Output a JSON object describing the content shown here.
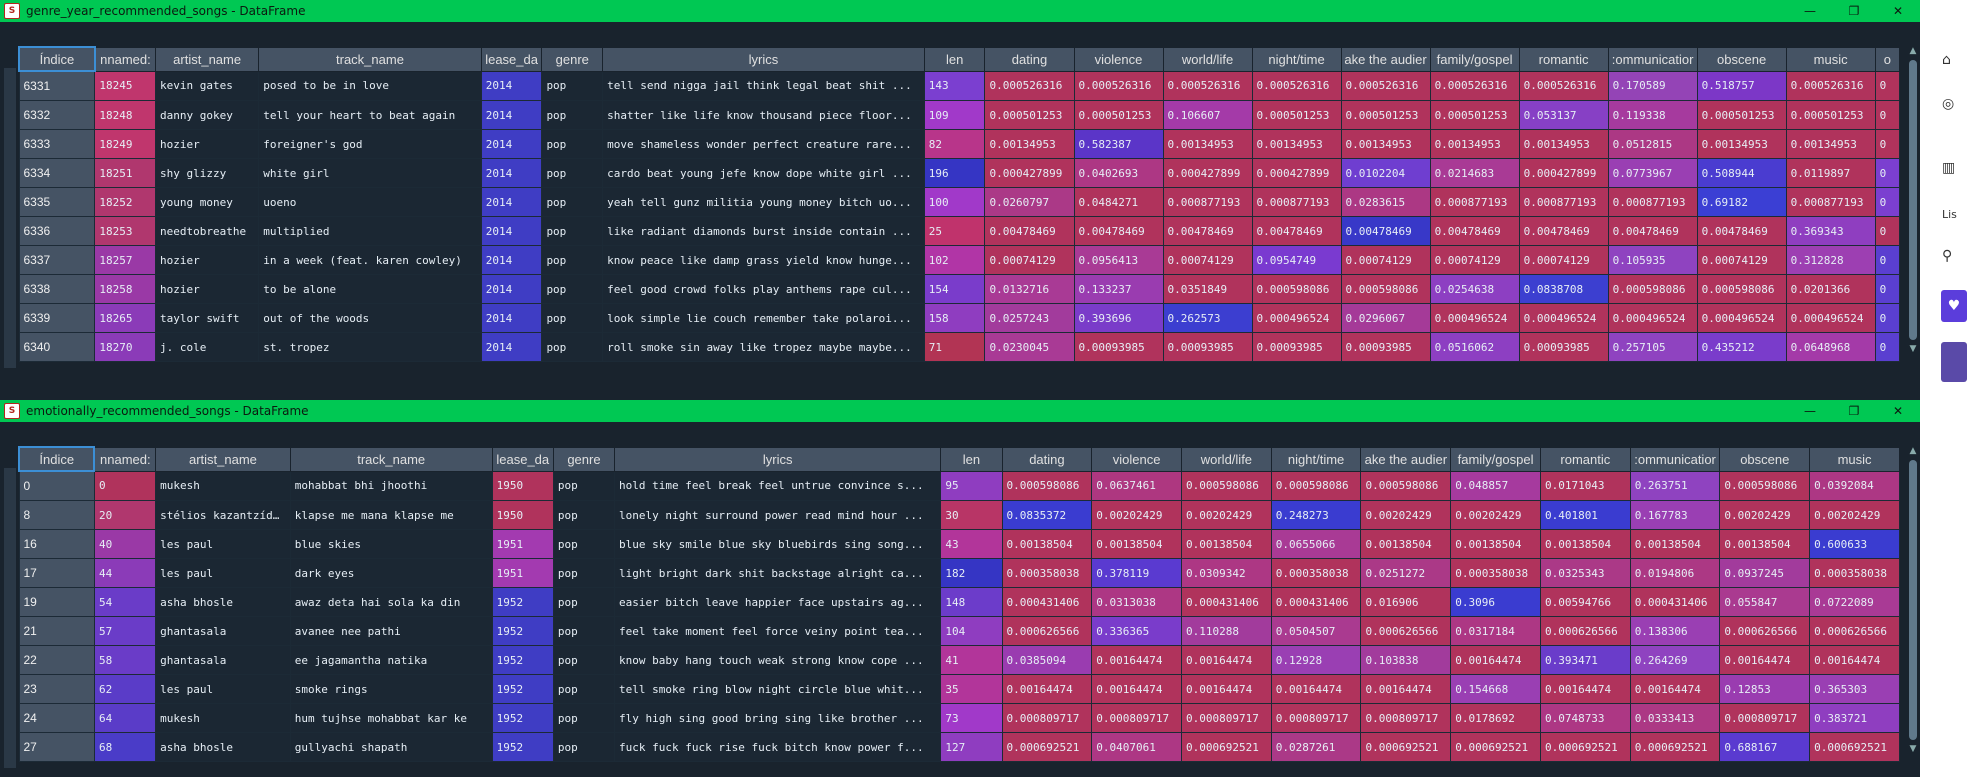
{
  "windows": [
    {
      "title": "genre_year_recommended_songs - DataFrame",
      "app_icon": "spyder-icon",
      "columns": [
        "Índice",
        "nnamed:",
        "artist_name",
        "track_name",
        "lease_da",
        "genre",
        "lyrics",
        "len",
        "dating",
        "violence",
        "world/life",
        "night/time",
        "ake the audier",
        "family/gospel",
        "romantic",
        ":ommunicatior",
        "obscene",
        "music",
        "o"
      ],
      "rows": [
        [
          "6331",
          "18245",
          "kevin gates",
          "posed to be in love",
          "2014",
          "pop",
          "tell send nigga jail think legal beat shit ...",
          "143",
          "0.000526316",
          "0.000526316",
          "0.000526316",
          "0.000526316",
          "0.000526316",
          "0.000526316",
          "0.000526316",
          "0.170589",
          "0.518757",
          "0.000526316",
          "0"
        ],
        [
          "6332",
          "18248",
          "danny gokey",
          "tell your heart to beat again",
          "2014",
          "pop",
          "shatter like life know thousand piece floor...",
          "109",
          "0.000501253",
          "0.000501253",
          "0.106607",
          "0.000501253",
          "0.000501253",
          "0.000501253",
          "0.053137",
          "0.119338",
          "0.000501253",
          "0.000501253",
          "0"
        ],
        [
          "6333",
          "18249",
          "hozier",
          "foreigner's god",
          "2014",
          "pop",
          "move shameless wonder perfect creature rare...",
          "82",
          "0.00134953",
          "0.582387",
          "0.00134953",
          "0.00134953",
          "0.00134953",
          "0.00134953",
          "0.00134953",
          "0.0512815",
          "0.00134953",
          "0.00134953",
          "0"
        ],
        [
          "6334",
          "18251",
          "shy glizzy",
          "white girl",
          "2014",
          "pop",
          "cardo beat young jefe know dope white girl ...",
          "196",
          "0.000427899",
          "0.0402693",
          "0.000427899",
          "0.000427899",
          "0.0102204",
          "0.0214683",
          "0.000427899",
          "0.0773967",
          "0.508944",
          "0.0119897",
          "0"
        ],
        [
          "6335",
          "18252",
          "young money",
          "uoeno",
          "2014",
          "pop",
          "yeah tell gunz militia young money bitch uo...",
          "100",
          "0.0260797",
          "0.0484271",
          "0.000877193",
          "0.000877193",
          "0.0283615",
          "0.000877193",
          "0.000877193",
          "0.000877193",
          "0.69182",
          "0.000877193",
          "0"
        ],
        [
          "6336",
          "18253",
          "needtobreathe",
          "multiplied",
          "2014",
          "pop",
          "like radiant diamonds burst inside contain ...",
          "25",
          "0.00478469",
          "0.00478469",
          "0.00478469",
          "0.00478469",
          "0.00478469",
          "0.00478469",
          "0.00478469",
          "0.00478469",
          "0.00478469",
          "0.369343",
          "0"
        ],
        [
          "6337",
          "18257",
          "hozier",
          "in a week (feat. karen cowley)",
          "2014",
          "pop",
          "know peace like damp grass yield know hunge...",
          "102",
          "0.00074129",
          "0.0956413",
          "0.00074129",
          "0.0954749",
          "0.00074129",
          "0.00074129",
          "0.00074129",
          "0.105935",
          "0.00074129",
          "0.312828",
          "0"
        ],
        [
          "6338",
          "18258",
          "hozier",
          "to be alone",
          "2014",
          "pop",
          "feel good crowd folks play anthems rape cul...",
          "154",
          "0.0132716",
          "0.133237",
          "0.0351849",
          "0.000598086",
          "0.000598086",
          "0.0254638",
          "0.0838708",
          "0.000598086",
          "0.000598086",
          "0.0201366",
          "0"
        ],
        [
          "6339",
          "18265",
          "taylor swift",
          "out of the woods",
          "2014",
          "pop",
          "look simple lie couch remember take polaroi...",
          "158",
          "0.0257243",
          "0.393696",
          "0.262573",
          "0.000496524",
          "0.0296067",
          "0.000496524",
          "0.000496524",
          "0.000496524",
          "0.000496524",
          "0.000496524",
          "0"
        ],
        [
          "6340",
          "18270",
          "j. cole",
          "st. tropez",
          "2014",
          "pop",
          "roll smoke sin away like tropez maybe maybe...",
          "71",
          "0.0230045",
          "0.00093985",
          "0.00093985",
          "0.00093985",
          "0.00093985",
          "0.0516062",
          "0.00093985",
          "0.257105",
          "0.435212",
          "0.0648968",
          "0"
        ]
      ],
      "cell_colors": [
        [
          "#455364",
          "#c0366d",
          "#1b2733",
          "#1b2733",
          "#3f3dc4",
          "#1b2733",
          "#1b2733",
          "#7b3fd0",
          "#b0335c",
          "#b0335c",
          "#b0335c",
          "#b0335c",
          "#b0335c",
          "#b0335c",
          "#b0335c",
          "#9444b6",
          "#7c37c7",
          "#b0335c",
          "#b0335c"
        ],
        [
          "#455364",
          "#c0366d",
          "#1b2733",
          "#1b2733",
          "#3f3dc4",
          "#1b2733",
          "#1b2733",
          "#a139c9",
          "#b0335c",
          "#b0335c",
          "#a43aa8",
          "#b0335c",
          "#b0335c",
          "#b0335c",
          "#8740c5",
          "#a63a9e",
          "#b0335c",
          "#b0335c",
          "#b0335c"
        ],
        [
          "#455364",
          "#c0366d",
          "#1b2733",
          "#1b2733",
          "#3f3dc4",
          "#1b2733",
          "#1b2733",
          "#b8358a",
          "#b0335c",
          "#5b35c8",
          "#b0335c",
          "#b0335c",
          "#b0335c",
          "#b0335c",
          "#b0335c",
          "#ac3884",
          "#b0335c",
          "#b0335c",
          "#b0335c"
        ],
        [
          "#455364",
          "#b0376e",
          "#1b2733",
          "#1b2733",
          "#3f3dc4",
          "#1b2733",
          "#1b2733",
          "#3535c4",
          "#b0335c",
          "#ad3784",
          "#b0335c",
          "#b0335c",
          "#6f3ed0",
          "#a93a95",
          "#b0335c",
          "#9a3fb3",
          "#4a3cd0",
          "#b0335c",
          "#7b3fd0"
        ],
        [
          "#455364",
          "#b0376e",
          "#1b2733",
          "#1b2733",
          "#3f3dc4",
          "#1b2733",
          "#1b2733",
          "#a139c9",
          "#ab3987",
          "#b0335c",
          "#b0335c",
          "#b0335c",
          "#ac3884",
          "#b0335c",
          "#b0335c",
          "#b0335c",
          "#3b3fd4",
          "#b0335c",
          "#7b3fd0"
        ],
        [
          "#455364",
          "#b0376e",
          "#1b2733",
          "#1b2733",
          "#3f3dc4",
          "#1b2733",
          "#1b2733",
          "#c0336c",
          "#b0335c",
          "#b0335c",
          "#b0335c",
          "#b0335c",
          "#3838c8",
          "#b0335c",
          "#b0335c",
          "#b0335c",
          "#b0335c",
          "#8f3ec0",
          "#b0335c"
        ],
        [
          "#455364",
          "#9a39a6",
          "#1b2733",
          "#1b2733",
          "#3f3dc4",
          "#1b2733",
          "#1b2733",
          "#b135a6",
          "#b0335c",
          "#a93a95",
          "#b0335c",
          "#7a3ad0",
          "#b0335c",
          "#b0335c",
          "#b0335c",
          "#8f43c0",
          "#b0335c",
          "#9d3fb2",
          "#5a3fd0"
        ],
        [
          "#455364",
          "#9a39a6",
          "#1b2733",
          "#1b2733",
          "#3f3dc4",
          "#1b2733",
          "#1b2733",
          "#7a3ccb",
          "#a93a95",
          "#9a3cb0",
          "#b0335c",
          "#b0335c",
          "#b0335c",
          "#8d3fc2",
          "#3c3fd0",
          "#b0335c",
          "#b0335c",
          "#b0335c",
          "#5a3fd0"
        ],
        [
          "#455364",
          "#8b3bb8",
          "#1b2733",
          "#1b2733",
          "#3f3dc4",
          "#1b2733",
          "#1b2733",
          "#8f3dc0",
          "#a23b9c",
          "#7a3cc9",
          "#3c3ed0",
          "#b0335c",
          "#a53a98",
          "#b0335c",
          "#b0335c",
          "#b0335c",
          "#b0335c",
          "#b0335c",
          "#5a3fd0"
        ],
        [
          "#455364",
          "#8b3bb8",
          "#1b2733",
          "#1b2733",
          "#3f3dc4",
          "#1b2733",
          "#1b2733",
          "#b23454",
          "#a93a95",
          "#b0335c",
          "#b0335c",
          "#b0335c",
          "#b0335c",
          "#8d3fc2",
          "#b0335c",
          "#8f43c0",
          "#7a3ccb",
          "#a43aa8",
          "#5a3fd0"
        ]
      ]
    },
    {
      "title": "emotionally_recommended_songs - DataFrame",
      "app_icon": "spyder-icon",
      "columns": [
        "Índice",
        "nnamed:",
        "artist_name",
        "track_name",
        "lease_da",
        "genre",
        "lyrics",
        "len",
        "dating",
        "violence",
        "world/life",
        "night/time",
        "ake the audier",
        "family/gospel",
        "romantic",
        ":ommunicatior",
        "obscene",
        "music"
      ],
      "rows": [
        [
          "0",
          "0",
          "mukesh",
          "mohabbat bhi jhoothi",
          "1950",
          "pop",
          "hold time feel break feel untrue convince s...",
          "95",
          "0.000598086",
          "0.0637461",
          "0.000598086",
          "0.000598086",
          "0.000598086",
          "0.048857",
          "0.0171043",
          "0.263751",
          "0.000598086",
          "0.0392084"
        ],
        [
          "8",
          "20",
          "stélios kazantzídis",
          "klapse me mana klapse me",
          "1950",
          "pop",
          "lonely night surround power read mind hour ...",
          "30",
          "0.0835372",
          "0.00202429",
          "0.00202429",
          "0.248273",
          "0.00202429",
          "0.00202429",
          "0.401801",
          "0.167783",
          "0.00202429",
          "0.00202429"
        ],
        [
          "16",
          "40",
          "les paul",
          "blue skies",
          "1951",
          "pop",
          "blue sky smile blue sky bluebirds sing song...",
          "43",
          "0.00138504",
          "0.00138504",
          "0.00138504",
          "0.0655066",
          "0.00138504",
          "0.00138504",
          "0.00138504",
          "0.00138504",
          "0.00138504",
          "0.600633"
        ],
        [
          "17",
          "44",
          "les paul",
          "dark eyes",
          "1951",
          "pop",
          "light bright dark shit backstage alright ca...",
          "182",
          "0.000358038",
          "0.378119",
          "0.0309342",
          "0.000358038",
          "0.0251272",
          "0.000358038",
          "0.0325343",
          "0.0194806",
          "0.0937245",
          "0.000358038"
        ],
        [
          "19",
          "54",
          "asha bhosle",
          "awaz deta hai sola ka din",
          "1952",
          "pop",
          "easier bitch leave happier face upstairs ag...",
          "148",
          "0.000431406",
          "0.0313038",
          "0.000431406",
          "0.000431406",
          "0.016906",
          "0.3096",
          "0.00594766",
          "0.000431406",
          "0.055847",
          "0.0722089"
        ],
        [
          "21",
          "57",
          "ghantasala",
          "avanee nee pathi",
          "1952",
          "pop",
          "feel take moment feel force veiny point tea...",
          "104",
          "0.000626566",
          "0.336365",
          "0.110288",
          "0.0504507",
          "0.000626566",
          "0.0317184",
          "0.000626566",
          "0.138306",
          "0.000626566",
          "0.000626566"
        ],
        [
          "22",
          "58",
          "ghantasala",
          "ee jagamantha natika",
          "1952",
          "pop",
          "know baby hang touch weak strong know cope ...",
          "41",
          "0.0385094",
          "0.00164474",
          "0.00164474",
          "0.12928",
          "0.103838",
          "0.00164474",
          "0.393471",
          "0.264269",
          "0.00164474",
          "0.00164474"
        ],
        [
          "23",
          "62",
          "les paul",
          "smoke rings",
          "1952",
          "pop",
          "tell smoke ring blow night circle blue whit...",
          "35",
          "0.00164474",
          "0.00164474",
          "0.00164474",
          "0.00164474",
          "0.00164474",
          "0.154668",
          "0.00164474",
          "0.00164474",
          "0.12853",
          "0.365303"
        ],
        [
          "24",
          "64",
          "mukesh",
          "hum tujhse mohabbat kar ke",
          "1952",
          "pop",
          "fly high sing good bring sing like brother ...",
          "73",
          "0.000809717",
          "0.000809717",
          "0.000809717",
          "0.000809717",
          "0.000809717",
          "0.0178692",
          "0.0748733",
          "0.0333413",
          "0.000809717",
          "0.383721"
        ],
        [
          "27",
          "68",
          "asha bhosle",
          "gullyachi shapath",
          "1952",
          "pop",
          "fuck fuck fuck rise fuck bitch know power f...",
          "127",
          "0.000692521",
          "0.0407061",
          "0.000692521",
          "0.0287261",
          "0.000692521",
          "0.000692521",
          "0.000692521",
          "0.000692521",
          "0.688167",
          "0.000692521"
        ]
      ],
      "cell_colors": [
        [
          "#455364",
          "#b0335c",
          "#1b2733",
          "#1b2733",
          "#b0335c",
          "#1b2733",
          "#1b2733",
          "#8f3dc0",
          "#b0335c",
          "#ae3780",
          "#b0335c",
          "#b0335c",
          "#b0335c",
          "#a63a9e",
          "#b0335c",
          "#8f43c0",
          "#b0335c",
          "#ad3784"
        ],
        [
          "#455364",
          "#b0376e",
          "#1b2733",
          "#1b2733",
          "#b0335c",
          "#1b2733",
          "#1b2733",
          "#b83566",
          "#3a3cd0",
          "#b0335c",
          "#b0335c",
          "#3a3cd0",
          "#b0335c",
          "#b0335c",
          "#3a3cd0",
          "#9a3fb3",
          "#b0335c",
          "#b0335c"
        ],
        [
          "#455364",
          "#9a39a6",
          "#1b2733",
          "#1b2733",
          "#a33ab0",
          "#1b2733",
          "#1b2733",
          "#b2359a",
          "#b0335c",
          "#b0335c",
          "#b0335c",
          "#a93a95",
          "#b0335c",
          "#b0335c",
          "#b0335c",
          "#b0335c",
          "#b0335c",
          "#3a3cd0"
        ],
        [
          "#455364",
          "#8b3bb8",
          "#1b2733",
          "#1b2733",
          "#a33ab0",
          "#1b2733",
          "#1b2733",
          "#3535c4",
          "#b0335c",
          "#5a3ad0",
          "#ad3784",
          "#b0335c",
          "#ab3987",
          "#b0335c",
          "#ab3987",
          "#ac3884",
          "#a23b9c",
          "#b0335c"
        ],
        [
          "#455364",
          "#6a3cc8",
          "#1b2733",
          "#1b2733",
          "#3f3dc4",
          "#1b2733",
          "#1b2733",
          "#6c3cca",
          "#b0335c",
          "#ad3784",
          "#b0335c",
          "#b0335c",
          "#b0335c",
          "#3a3cd0",
          "#b0335c",
          "#b0335c",
          "#aa3a90",
          "#a93a95"
        ],
        [
          "#455364",
          "#6a3cc8",
          "#1b2733",
          "#1b2733",
          "#3f3dc4",
          "#1b2733",
          "#1b2733",
          "#8f3dc0",
          "#b0335c",
          "#7a3ccb",
          "#a23b9c",
          "#aa3a90",
          "#b0335c",
          "#ad3784",
          "#b0335c",
          "#9a3fb3",
          "#b0335c",
          "#b0335c"
        ],
        [
          "#455364",
          "#6a3cc8",
          "#1b2733",
          "#1b2733",
          "#3f3dc4",
          "#1b2733",
          "#1b2733",
          "#b2359a",
          "#9a3cb0",
          "#b0335c",
          "#b0335c",
          "#9a3fb3",
          "#a23b9c",
          "#b0335c",
          "#6a3cca",
          "#8f43c0",
          "#b0335c",
          "#b0335c"
        ],
        [
          "#455364",
          "#5a3cc8",
          "#1b2733",
          "#1b2733",
          "#3f3dc4",
          "#1b2733",
          "#1b2733",
          "#b2359a",
          "#b0335c",
          "#b0335c",
          "#b0335c",
          "#b0335c",
          "#b0335c",
          "#9a3fb3",
          "#b0335c",
          "#b0335c",
          "#9a3cb0",
          "#9a3fb3"
        ],
        [
          "#455364",
          "#5a3cc8",
          "#1b2733",
          "#1b2733",
          "#3f3dc4",
          "#1b2733",
          "#1b2733",
          "#a139c9",
          "#b0335c",
          "#b0335c",
          "#b0335c",
          "#b0335c",
          "#b0335c",
          "#b0335c",
          "#ad3784",
          "#ac3884",
          "#b0335c",
          "#8f3ec0"
        ],
        [
          "#455364",
          "#4a3cc8",
          "#1b2733",
          "#1b2733",
          "#3f3dc4",
          "#1b2733",
          "#1b2733",
          "#8f3dc0",
          "#b0335c",
          "#ad3784",
          "#b0335c",
          "#ab3987",
          "#b0335c",
          "#b0335c",
          "#b0335c",
          "#b0335c",
          "#5a3ad0",
          "#b0335c"
        ]
      ]
    }
  ],
  "window_controls": {
    "minimize": "—",
    "maximize": "❐",
    "close": "✕"
  },
  "side_panel": {
    "label": "Lis"
  }
}
